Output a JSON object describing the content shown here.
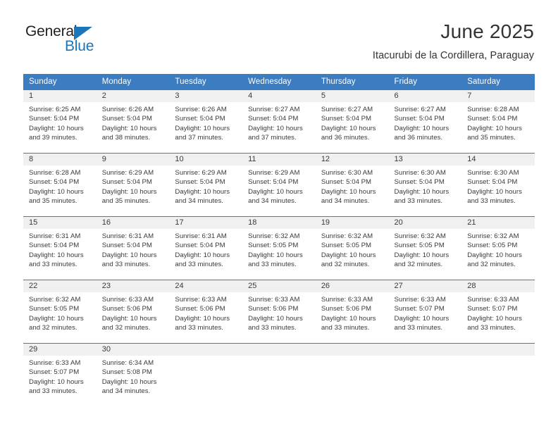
{
  "logo": {
    "word1": "General",
    "word2": "Blue",
    "triangle_color": "#1b75bb",
    "word1_color": "#231f20",
    "word2_color": "#1b75bb"
  },
  "header": {
    "month_title": "June 2025",
    "location": "Itacurubi de la Cordillera, Paraguay"
  },
  "theme": {
    "header_blue": "#3c7cc0",
    "day_band_gray": "#f0f0f0",
    "text_gray": "#3a3a3a",
    "title_gray": "#333333"
  },
  "calendar": {
    "weekday_headers": [
      "Sunday",
      "Monday",
      "Tuesday",
      "Wednesday",
      "Thursday",
      "Friday",
      "Saturday"
    ],
    "weeks": [
      [
        {
          "day": "1",
          "sunrise": "Sunrise: 6:25 AM",
          "sunset": "Sunset: 5:04 PM",
          "daylight_1": "Daylight: 10 hours",
          "daylight_2": "and 39 minutes."
        },
        {
          "day": "2",
          "sunrise": "Sunrise: 6:26 AM",
          "sunset": "Sunset: 5:04 PM",
          "daylight_1": "Daylight: 10 hours",
          "daylight_2": "and 38 minutes."
        },
        {
          "day": "3",
          "sunrise": "Sunrise: 6:26 AM",
          "sunset": "Sunset: 5:04 PM",
          "daylight_1": "Daylight: 10 hours",
          "daylight_2": "and 37 minutes."
        },
        {
          "day": "4",
          "sunrise": "Sunrise: 6:27 AM",
          "sunset": "Sunset: 5:04 PM",
          "daylight_1": "Daylight: 10 hours",
          "daylight_2": "and 37 minutes."
        },
        {
          "day": "5",
          "sunrise": "Sunrise: 6:27 AM",
          "sunset": "Sunset: 5:04 PM",
          "daylight_1": "Daylight: 10 hours",
          "daylight_2": "and 36 minutes."
        },
        {
          "day": "6",
          "sunrise": "Sunrise: 6:27 AM",
          "sunset": "Sunset: 5:04 PM",
          "daylight_1": "Daylight: 10 hours",
          "daylight_2": "and 36 minutes."
        },
        {
          "day": "7",
          "sunrise": "Sunrise: 6:28 AM",
          "sunset": "Sunset: 5:04 PM",
          "daylight_1": "Daylight: 10 hours",
          "daylight_2": "and 35 minutes."
        }
      ],
      [
        {
          "day": "8",
          "sunrise": "Sunrise: 6:28 AM",
          "sunset": "Sunset: 5:04 PM",
          "daylight_1": "Daylight: 10 hours",
          "daylight_2": "and 35 minutes."
        },
        {
          "day": "9",
          "sunrise": "Sunrise: 6:29 AM",
          "sunset": "Sunset: 5:04 PM",
          "daylight_1": "Daylight: 10 hours",
          "daylight_2": "and 35 minutes."
        },
        {
          "day": "10",
          "sunrise": "Sunrise: 6:29 AM",
          "sunset": "Sunset: 5:04 PM",
          "daylight_1": "Daylight: 10 hours",
          "daylight_2": "and 34 minutes."
        },
        {
          "day": "11",
          "sunrise": "Sunrise: 6:29 AM",
          "sunset": "Sunset: 5:04 PM",
          "daylight_1": "Daylight: 10 hours",
          "daylight_2": "and 34 minutes."
        },
        {
          "day": "12",
          "sunrise": "Sunrise: 6:30 AM",
          "sunset": "Sunset: 5:04 PM",
          "daylight_1": "Daylight: 10 hours",
          "daylight_2": "and 34 minutes."
        },
        {
          "day": "13",
          "sunrise": "Sunrise: 6:30 AM",
          "sunset": "Sunset: 5:04 PM",
          "daylight_1": "Daylight: 10 hours",
          "daylight_2": "and 33 minutes."
        },
        {
          "day": "14",
          "sunrise": "Sunrise: 6:30 AM",
          "sunset": "Sunset: 5:04 PM",
          "daylight_1": "Daylight: 10 hours",
          "daylight_2": "and 33 minutes."
        }
      ],
      [
        {
          "day": "15",
          "sunrise": "Sunrise: 6:31 AM",
          "sunset": "Sunset: 5:04 PM",
          "daylight_1": "Daylight: 10 hours",
          "daylight_2": "and 33 minutes."
        },
        {
          "day": "16",
          "sunrise": "Sunrise: 6:31 AM",
          "sunset": "Sunset: 5:04 PM",
          "daylight_1": "Daylight: 10 hours",
          "daylight_2": "and 33 minutes."
        },
        {
          "day": "17",
          "sunrise": "Sunrise: 6:31 AM",
          "sunset": "Sunset: 5:04 PM",
          "daylight_1": "Daylight: 10 hours",
          "daylight_2": "and 33 minutes."
        },
        {
          "day": "18",
          "sunrise": "Sunrise: 6:32 AM",
          "sunset": "Sunset: 5:05 PM",
          "daylight_1": "Daylight: 10 hours",
          "daylight_2": "and 33 minutes."
        },
        {
          "day": "19",
          "sunrise": "Sunrise: 6:32 AM",
          "sunset": "Sunset: 5:05 PM",
          "daylight_1": "Daylight: 10 hours",
          "daylight_2": "and 32 minutes."
        },
        {
          "day": "20",
          "sunrise": "Sunrise: 6:32 AM",
          "sunset": "Sunset: 5:05 PM",
          "daylight_1": "Daylight: 10 hours",
          "daylight_2": "and 32 minutes."
        },
        {
          "day": "21",
          "sunrise": "Sunrise: 6:32 AM",
          "sunset": "Sunset: 5:05 PM",
          "daylight_1": "Daylight: 10 hours",
          "daylight_2": "and 32 minutes."
        }
      ],
      [
        {
          "day": "22",
          "sunrise": "Sunrise: 6:32 AM",
          "sunset": "Sunset: 5:05 PM",
          "daylight_1": "Daylight: 10 hours",
          "daylight_2": "and 32 minutes."
        },
        {
          "day": "23",
          "sunrise": "Sunrise: 6:33 AM",
          "sunset": "Sunset: 5:06 PM",
          "daylight_1": "Daylight: 10 hours",
          "daylight_2": "and 32 minutes."
        },
        {
          "day": "24",
          "sunrise": "Sunrise: 6:33 AM",
          "sunset": "Sunset: 5:06 PM",
          "daylight_1": "Daylight: 10 hours",
          "daylight_2": "and 33 minutes."
        },
        {
          "day": "25",
          "sunrise": "Sunrise: 6:33 AM",
          "sunset": "Sunset: 5:06 PM",
          "daylight_1": "Daylight: 10 hours",
          "daylight_2": "and 33 minutes."
        },
        {
          "day": "26",
          "sunrise": "Sunrise: 6:33 AM",
          "sunset": "Sunset: 5:06 PM",
          "daylight_1": "Daylight: 10 hours",
          "daylight_2": "and 33 minutes."
        },
        {
          "day": "27",
          "sunrise": "Sunrise: 6:33 AM",
          "sunset": "Sunset: 5:07 PM",
          "daylight_1": "Daylight: 10 hours",
          "daylight_2": "and 33 minutes."
        },
        {
          "day": "28",
          "sunrise": "Sunrise: 6:33 AM",
          "sunset": "Sunset: 5:07 PM",
          "daylight_1": "Daylight: 10 hours",
          "daylight_2": "and 33 minutes."
        }
      ],
      [
        {
          "day": "29",
          "sunrise": "Sunrise: 6:33 AM",
          "sunset": "Sunset: 5:07 PM",
          "daylight_1": "Daylight: 10 hours",
          "daylight_2": "and 33 minutes."
        },
        {
          "day": "30",
          "sunrise": "Sunrise: 6:34 AM",
          "sunset": "Sunset: 5:08 PM",
          "daylight_1": "Daylight: 10 hours",
          "daylight_2": "and 34 minutes."
        },
        {
          "day": "",
          "sunrise": "",
          "sunset": "",
          "daylight_1": "",
          "daylight_2": ""
        },
        {
          "day": "",
          "sunrise": "",
          "sunset": "",
          "daylight_1": "",
          "daylight_2": ""
        },
        {
          "day": "",
          "sunrise": "",
          "sunset": "",
          "daylight_1": "",
          "daylight_2": ""
        },
        {
          "day": "",
          "sunrise": "",
          "sunset": "",
          "daylight_1": "",
          "daylight_2": ""
        },
        {
          "day": "",
          "sunrise": "",
          "sunset": "",
          "daylight_1": "",
          "daylight_2": ""
        }
      ]
    ]
  }
}
